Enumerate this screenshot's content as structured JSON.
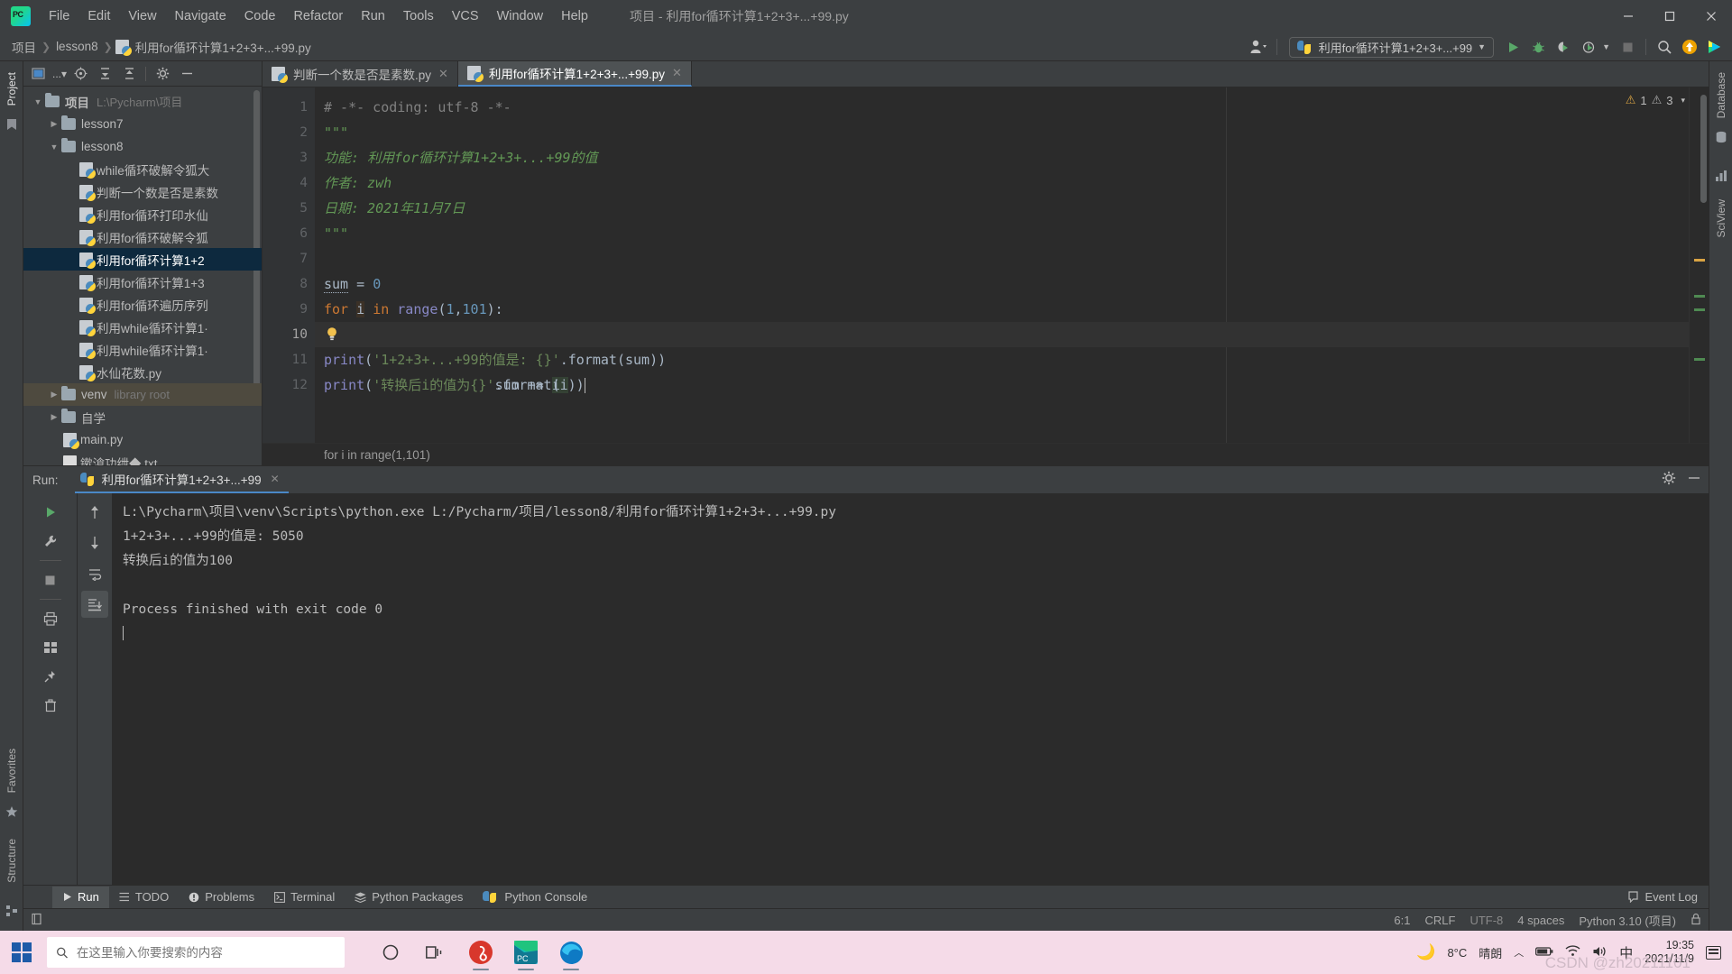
{
  "window": {
    "title": "项目 - 利用for循环计算1+2+3+...+99.py",
    "minimize": "—",
    "maximize": "▢",
    "close": "✕"
  },
  "menu": [
    {
      "label": "File"
    },
    {
      "label": "Edit"
    },
    {
      "label": "View"
    },
    {
      "label": "Navigate"
    },
    {
      "label": "Code"
    },
    {
      "label": "Refactor"
    },
    {
      "label": "Run"
    },
    {
      "label": "Tools"
    },
    {
      "label": "VCS"
    },
    {
      "label": "Window"
    },
    {
      "label": "Help"
    }
  ],
  "breadcrumbs": [
    "项目",
    "lesson8",
    "利用for循环计算1+2+3+...+99.py"
  ],
  "toolbar": {
    "run_config": "利用for循环计算1+2+3+...+99",
    "run_tooltip": "Run",
    "debug_tooltip": "Debug",
    "coverage_tooltip": "Run with Coverage",
    "profile_tooltip": "Profile",
    "stop_tooltip": "Stop",
    "search_tooltip": "Search Everywhere",
    "update_tooltip": "Update Project",
    "ide_tooltip": "IDE and Project Settings"
  },
  "left_rail": {
    "project_label": "Project",
    "structure_label": "Structure",
    "favorites_label": "Favorites"
  },
  "right_rail": {
    "database_label": "Database",
    "sciview_label": "SciView"
  },
  "project_panel": {
    "tree": [
      {
        "indent": 0,
        "arrow": "▼",
        "icon": "folder",
        "label": "项目",
        "sub": "L:\\Pycharm\\项目",
        "state": "normal"
      },
      {
        "indent": 1,
        "arrow": "▶",
        "icon": "folder",
        "label": "lesson7",
        "sub": "",
        "state": "normal"
      },
      {
        "indent": 1,
        "arrow": "▼",
        "icon": "folder",
        "label": "lesson8",
        "sub": "",
        "state": "normal"
      },
      {
        "indent": 2,
        "arrow": "",
        "icon": "python",
        "label": "while循环破解令狐大",
        "sub": "",
        "state": "normal"
      },
      {
        "indent": 2,
        "arrow": "",
        "icon": "python",
        "label": "判断一个数是否是素数",
        "sub": "",
        "state": "normal"
      },
      {
        "indent": 2,
        "arrow": "",
        "icon": "python",
        "label": "利用for循环打印水仙",
        "sub": "",
        "state": "normal"
      },
      {
        "indent": 2,
        "arrow": "",
        "icon": "python",
        "label": "利用for循环破解令狐",
        "sub": "",
        "state": "normal"
      },
      {
        "indent": 2,
        "arrow": "",
        "icon": "python",
        "label": "利用for循环计算1+2",
        "sub": "",
        "state": "selected"
      },
      {
        "indent": 2,
        "arrow": "",
        "icon": "python",
        "label": "利用for循环计算1+3",
        "sub": "",
        "state": "normal"
      },
      {
        "indent": 2,
        "arrow": "",
        "icon": "python",
        "label": "利用for循环遍历序列",
        "sub": "",
        "state": "normal"
      },
      {
        "indent": 2,
        "arrow": "",
        "icon": "python",
        "label": "利用while循环计算1·",
        "sub": "",
        "state": "normal"
      },
      {
        "indent": 2,
        "arrow": "",
        "icon": "python",
        "label": "利用while循环计算1·",
        "sub": "",
        "state": "normal"
      },
      {
        "indent": 2,
        "arrow": "",
        "icon": "python",
        "label": "水仙花数.py",
        "sub": "",
        "state": "normal"
      },
      {
        "indent": 1,
        "arrow": "▶",
        "icon": "folder",
        "label": "venv",
        "sub": "library root",
        "state": "highlight"
      },
      {
        "indent": 1,
        "arrow": "▶",
        "icon": "folder",
        "label": "自学",
        "sub": "",
        "state": "normal"
      },
      {
        "indent": 2,
        "arrow": "",
        "icon": "python",
        "label": "main.py",
        "sub": "",
        "state": "normal"
      },
      {
        "indent": 2,
        "arrow": "",
        "icon": "text",
        "label": "鏉滄功绁◆.txt",
        "sub": "",
        "state": "normal"
      }
    ]
  },
  "editor": {
    "tabs": [
      {
        "label": "判断一个数是否是素数.py",
        "active": false
      },
      {
        "label": "利用for循环计算1+2+3+...+99.py",
        "active": true
      }
    ],
    "inspection": {
      "warnings": "1",
      "weak_warnings": "3"
    },
    "line_numbers": [
      "1",
      "2",
      "3",
      "4",
      "5",
      "6",
      "7",
      "8",
      "9",
      "10",
      "11",
      "12"
    ],
    "current_line": 10,
    "breadcrumb": "for i in range(1,101)",
    "code": [
      {
        "n": 1,
        "plain": "# -*- coding: utf-8 -*-"
      },
      {
        "n": 2,
        "plain": "\"\"\""
      },
      {
        "n": 3,
        "plain": "功能: 利用for循环计算1+2+3+...+99的值"
      },
      {
        "n": 4,
        "plain": "作者: zwh"
      },
      {
        "n": 5,
        "plain": "日期: 2021年11月7日"
      },
      {
        "n": 6,
        "plain": "\"\"\""
      },
      {
        "n": 7,
        "plain": ""
      },
      {
        "n": 8,
        "plain": "sum = 0"
      },
      {
        "n": 9,
        "plain": "for i in range(1,101):"
      },
      {
        "n": 10,
        "plain": "    sum += i"
      },
      {
        "n": 11,
        "plain": "print('1+2+3+...+99的值是: {}'.format(sum))"
      },
      {
        "n": 12,
        "plain": "print('转换后i的值为{}'.format(i))"
      }
    ],
    "tokens": {
      "l1_comment": "# -*- coding: utf-8 -*-",
      "l2_quote": "\"\"\"",
      "l3_text": "功能: 利用for循环计算1+2+3+...+99的值",
      "l4_text": "作者: zwh",
      "l5_text": "日期: 2021年11月7日",
      "l6_quote": "\"\"\"",
      "l8_sum": "sum",
      "l8_eq": " = ",
      "l8_zero": "0",
      "l9_for": "for",
      "l9_i": "i",
      "l9_in": "in",
      "l9_range": "range",
      "l9_open": "(",
      "l9_one": "1",
      "l9_comma": ",",
      "l9_101": "101",
      "l9_close": "):",
      "l10_sum": "sum",
      "l10_op": " += ",
      "l10_i": "i",
      "l11_print": "print",
      "l11_open": "(",
      "l11_str": "'1+2+3+...+99的值是: {}'",
      "l11_dot": ".",
      "l11_format": "format",
      "l11_arg": "(sum))",
      "l12_print": "print",
      "l12_open": "(",
      "l12_str": "'转换后i的值为{}'",
      "l12_dot": ".",
      "l12_format": "format",
      "l12_o2": "(",
      "l12_i": "i",
      "l12_close": "))"
    }
  },
  "run_panel": {
    "label": "Run:",
    "tab_title": "利用for循环计算1+2+3+...+99",
    "tab_close": "✕",
    "settings_icon": "gear-icon",
    "minimize_icon": "—",
    "console": [
      "L:\\Pycharm\\项目\\venv\\Scripts\\python.exe L:/Pycharm/项目/lesson8/利用for循环计算1+2+3+...+99.py",
      "1+2+3+...+99的值是: 5050",
      "转换后i的值为100",
      "",
      "Process finished with exit code 0"
    ]
  },
  "tool_window_bar": {
    "items": [
      {
        "label": "Run",
        "icon": "play-icon",
        "active": true
      },
      {
        "label": "TODO",
        "icon": "list-icon",
        "active": false
      },
      {
        "label": "Problems",
        "icon": "warning-icon",
        "active": false
      },
      {
        "label": "Terminal",
        "icon": "terminal-icon",
        "active": false
      },
      {
        "label": "Python Packages",
        "icon": "packages-icon",
        "active": false
      },
      {
        "label": "Python Console",
        "icon": "python-icon",
        "active": false
      }
    ],
    "event_log": "Event Log"
  },
  "statusbar": {
    "caret": "6:1",
    "line_sep": "CRLF",
    "encoding": "UTF-8",
    "indent": "4 spaces",
    "interpreter": "Python 3.10 (项目)",
    "lock_icon": "lock-icon"
  },
  "taskbar": {
    "search_placeholder": "在这里输入你要搜索的内容",
    "apps": [
      {
        "name": "cortana-icon"
      },
      {
        "name": "task-view-icon"
      },
      {
        "name": "netease-music-icon"
      },
      {
        "name": "pycharm-icon"
      },
      {
        "name": "edge-icon"
      }
    ],
    "weather_temp": "8°C",
    "weather_desc": "晴朗",
    "ime": "中",
    "time": "19:35",
    "date": "2021/11/9",
    "watermark": "CSDN @zh20211101"
  },
  "colors": {
    "accent": "#4a88c7",
    "editor_bg": "#2b2b2b",
    "panel_bg": "#3c3f41",
    "selection": "#0d293e",
    "string": "#6a8759",
    "keyword": "#cc7832",
    "number": "#6897bb",
    "docstring": "#629755",
    "taskbar_bg": "#f5dbe8"
  }
}
